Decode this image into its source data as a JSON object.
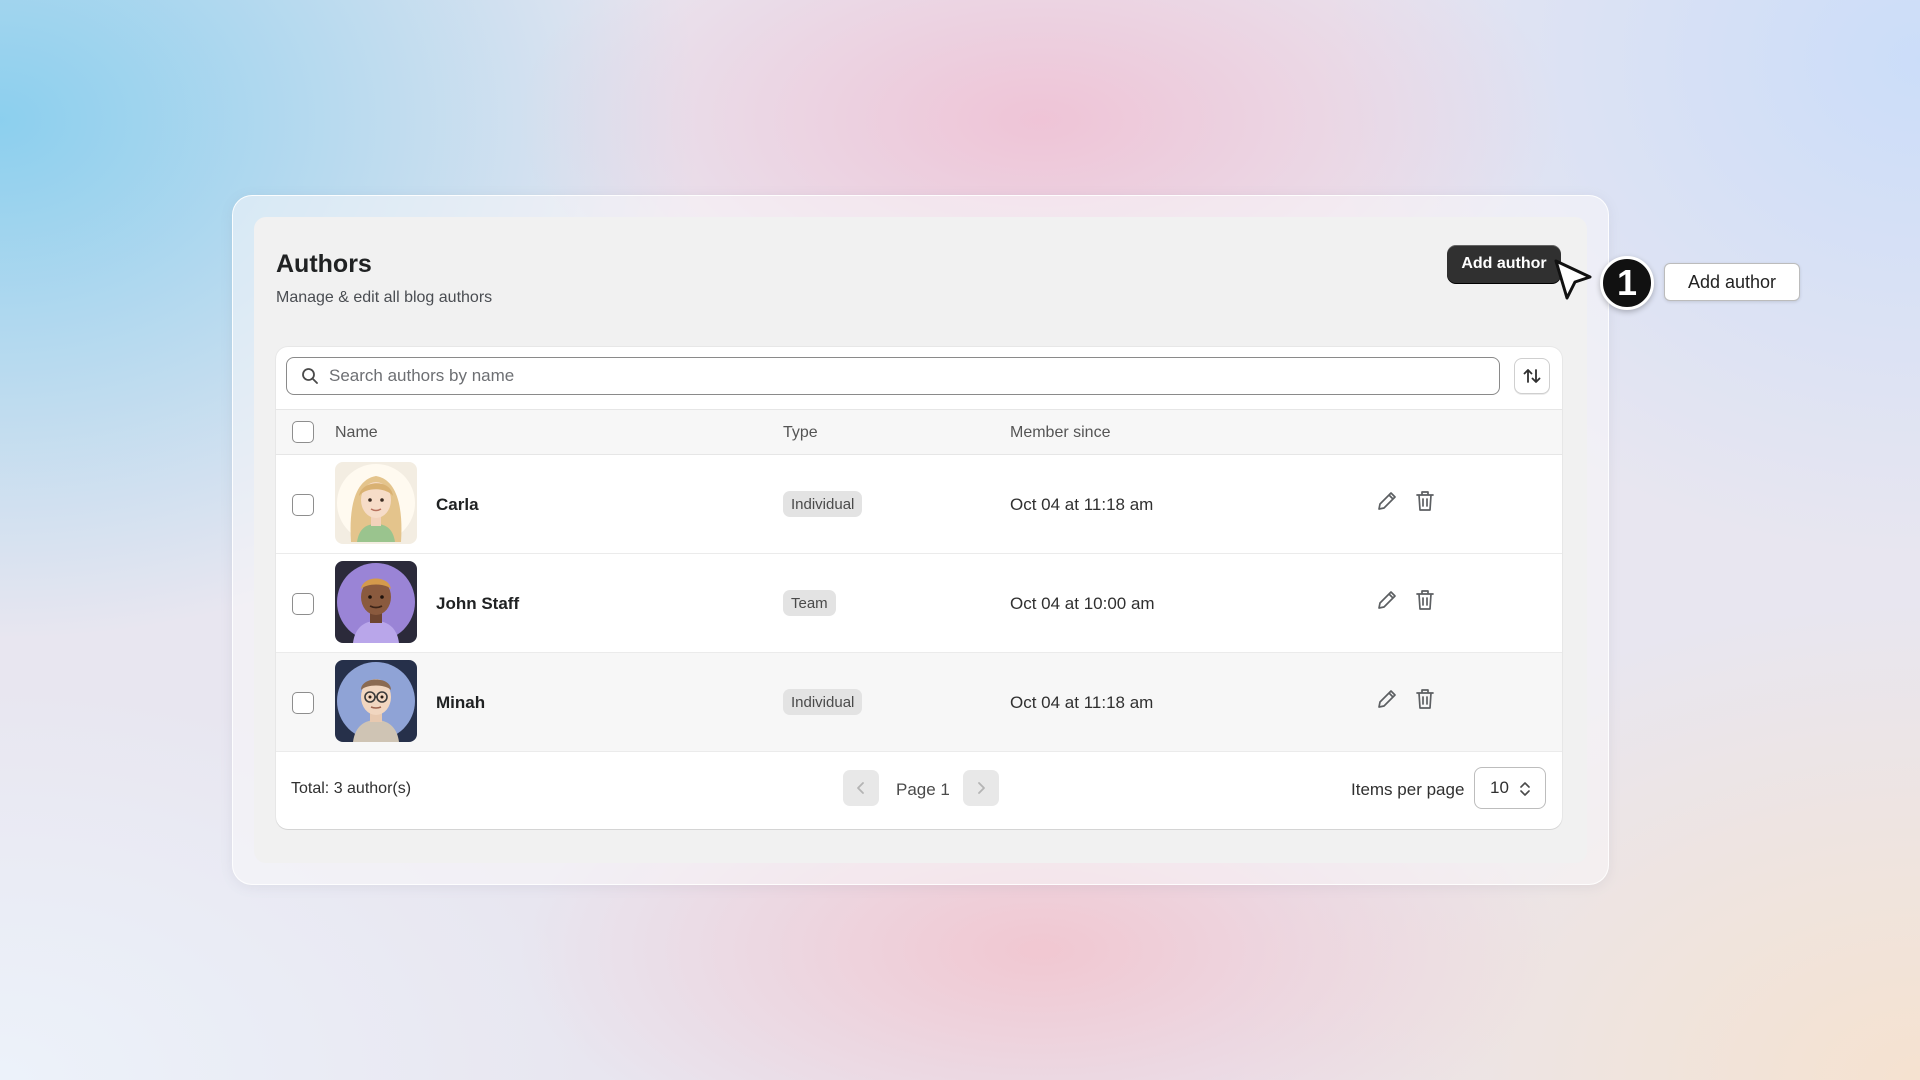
{
  "page": {
    "title": "Authors",
    "subtitle": "Manage & edit all blog authors",
    "add_button_label": "Add author"
  },
  "callout": {
    "step_number": "1",
    "label": "Add author"
  },
  "search": {
    "placeholder": "Search authors by name",
    "value": ""
  },
  "table": {
    "headers": {
      "name": "Name",
      "type": "Type",
      "member_since": "Member since"
    },
    "rows": [
      {
        "name": "Carla",
        "type": "Individual",
        "member_since": "Oct 04 at 11:18 am",
        "avatar": "woman-blonde-avatar"
      },
      {
        "name": "John Staff",
        "type": "Team",
        "member_since": "Oct 04 at 10:00 am",
        "avatar": "man-dark-avatar"
      },
      {
        "name": "Minah",
        "type": "Individual",
        "member_since": "Oct 04 at 11:18 am",
        "avatar": "man-glasses-avatar"
      }
    ]
  },
  "footer": {
    "total": "Total: 3 author(s)",
    "page_label": "Page 1",
    "items_per_page_label": "Items per page",
    "items_per_page_value": "10"
  },
  "icons": {
    "search": "search-icon",
    "sort": "sort-arrows-icon",
    "edit": "pencil-icon",
    "delete": "trash-icon",
    "prev": "chevron-left-icon",
    "next": "chevron-right-icon",
    "cursor": "mouse-pointer-icon"
  },
  "colors": {
    "primary_button": "#303030",
    "badge_bg": "#e3e3e3"
  }
}
